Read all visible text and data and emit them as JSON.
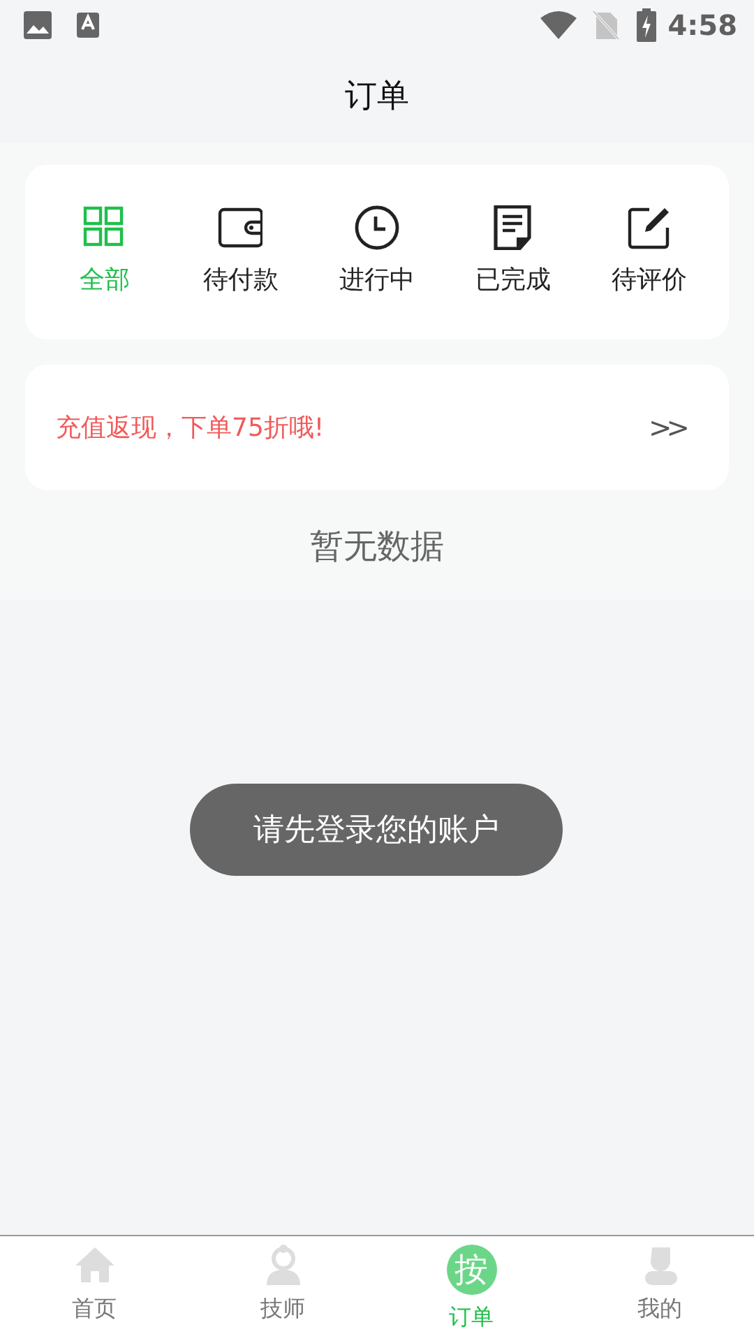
{
  "status_bar": {
    "time": "4:58"
  },
  "header": {
    "title": "订单"
  },
  "filters": [
    {
      "kind": "grid",
      "label": "全部",
      "selected": true
    },
    {
      "kind": "wallet",
      "label": "待付款",
      "selected": false
    },
    {
      "kind": "clock",
      "label": "进行中",
      "selected": false
    },
    {
      "kind": "document",
      "label": "已完成",
      "selected": false
    },
    {
      "kind": "edit",
      "label": "待评价",
      "selected": false
    }
  ],
  "promo": {
    "text": "充值返现，下单75折哦!",
    "arrow": ">>"
  },
  "empty_text": "暂无数据",
  "toast": "请先登录您的账户",
  "bottom_nav": [
    {
      "kind": "home",
      "label": "首页",
      "selected": false
    },
    {
      "kind": "staff",
      "label": "技师",
      "selected": false
    },
    {
      "kind": "glyph",
      "glyph": "按",
      "label": "订单",
      "selected": true
    },
    {
      "kind": "user",
      "label": "我的",
      "selected": false
    }
  ]
}
